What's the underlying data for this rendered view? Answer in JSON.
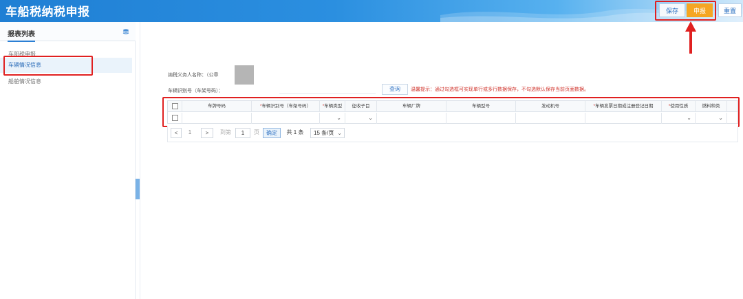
{
  "header": {
    "title": "车船税纳税申报",
    "buttons": {
      "save": "保存",
      "submit": "申报",
      "reset": "重置"
    }
  },
  "sidebar": {
    "title": "报表列表",
    "items": [
      {
        "label": "车船税申报"
      },
      {
        "label": "车辆情况信息"
      },
      {
        "label": "船舶情况信息"
      }
    ]
  },
  "form": {
    "taxpayer_label": "纳税义务人名称：（公章",
    "vin_label": "车辆识别号（车架号码）：",
    "vin_value": "",
    "query_button": "查询",
    "tip": "温馨提示：通过勾选框可实现单行或多行数据保存，不勾选默认保存当前页面数据。"
  },
  "table": {
    "columns": [
      {
        "label": "",
        "required": false
      },
      {
        "label": "车牌号码",
        "required": false
      },
      {
        "label": "车辆识别号（车架号码）",
        "required": true
      },
      {
        "label": "车辆类型",
        "required": true
      },
      {
        "label": "征收子目",
        "required": false
      },
      {
        "label": "车辆厂牌",
        "required": false
      },
      {
        "label": "车辆型号",
        "required": false
      },
      {
        "label": "发动机号",
        "required": false
      },
      {
        "label": "车辆发票日期或注册登记日期",
        "required": true
      },
      {
        "label": "使用性质",
        "required": true
      },
      {
        "label": "燃料种类",
        "required": false
      }
    ]
  },
  "pager": {
    "prev": "<",
    "page": "1",
    "next": ">",
    "goto_label": "到第",
    "page_input": "1",
    "page_suffix": "页",
    "confirm": "确定",
    "total": "共 1 条",
    "page_size": "15 条/页"
  },
  "colors": {
    "accent": "#2b7fd4",
    "submit": "#f5a623",
    "highlight": "#e02020"
  }
}
